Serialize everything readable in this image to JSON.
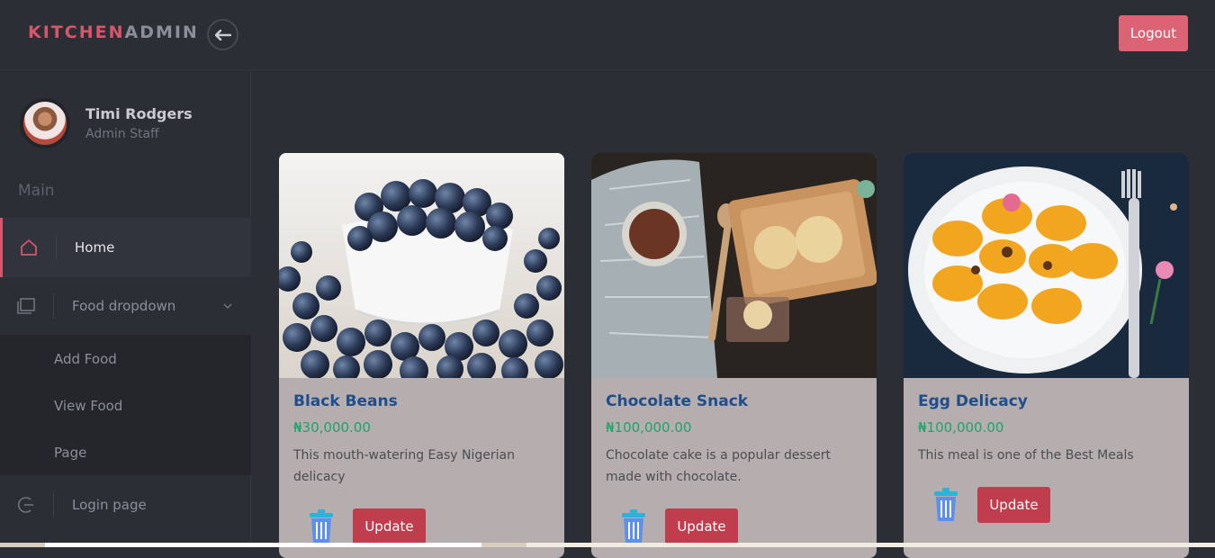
{
  "header": {
    "brand_part1": "KITCHEN",
    "brand_part2": "ADMIN",
    "logout_label": "Logout",
    "back_icon": "arrow-left-icon"
  },
  "sidebar": {
    "user_name": "Timi Rodgers",
    "user_role": "Admin Staff",
    "section_label": "Main",
    "items": [
      {
        "label": "Home",
        "icon": "home-icon",
        "active": true
      },
      {
        "label": "Food dropdown",
        "icon": "book-icon",
        "expanded": true
      },
      {
        "label": "Login page",
        "icon": "login-icon"
      }
    ],
    "subitems": [
      {
        "label": "Add Food"
      },
      {
        "label": "View Food"
      },
      {
        "label": "Page"
      }
    ]
  },
  "cards": [
    {
      "title": "Black Beans",
      "price": "₦30,000.00",
      "description": "This mouth-watering Easy Nigerian delicacy",
      "update_label": "Update",
      "delete_icon": "trash-icon"
    },
    {
      "title": "Chocolate Snack",
      "price": "₦100,000.00",
      "description": "Chocolate cake is a popular dessert made with chocolate.",
      "update_label": "Update",
      "delete_icon": "trash-icon"
    },
    {
      "title": "Egg Delicacy",
      "price": "₦100,000.00",
      "description": "This meal is one of the Best Meals",
      "update_label": "Update",
      "delete_icon": "trash-icon"
    }
  ],
  "colors": {
    "accent": "#d7566b",
    "card_bg": "#b5adae",
    "title": "#1f4e8c",
    "price": "#1aa66b",
    "update_button": "#c03d4d"
  }
}
